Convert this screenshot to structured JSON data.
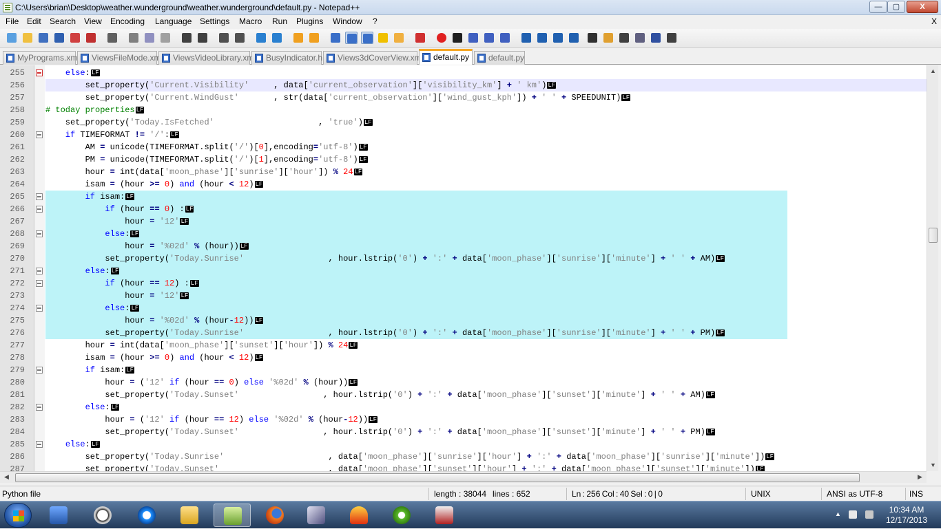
{
  "window": {
    "title": "C:\\Users\\brian\\Desktop\\weather.wunderground\\weather.wunderground\\default.py - Notepad++",
    "buttons": {
      "minimize": "—",
      "maximize": "▢",
      "close": "X"
    }
  },
  "menu": {
    "items": [
      "File",
      "Edit",
      "Search",
      "View",
      "Encoding",
      "Language",
      "Settings",
      "Macro",
      "Run",
      "Plugins",
      "Window",
      "?"
    ],
    "close_label": "X"
  },
  "toolbar": {
    "icons": [
      "new-file-icon",
      "open-file-icon",
      "save-icon",
      "save-all-icon",
      "close-file-icon",
      "close-all-icon",
      "print-icon",
      "cut-icon",
      "copy-icon",
      "paste-icon",
      "undo-icon",
      "redo-icon",
      "find-icon",
      "replace-icon",
      "zoom-in-icon",
      "zoom-out-icon",
      "sync-vertical-icon",
      "sync-horizontal-icon",
      "word-wrap-icon",
      "show-all-chars-icon",
      "indent-guide-icon",
      "user-language-icon",
      "doc-map-icon",
      "function-list-icon",
      "record-macro-icon",
      "stop-record-icon",
      "play-macro-icon",
      "run-macro-multiple-icon",
      "save-macro-icon",
      "collapse-icon",
      "prev-icon",
      "next-icon",
      "expand-icon",
      "spellcheck-icon",
      "highlight-icon",
      "compare-icon",
      "plugin-icon",
      "spell-icon",
      "print-preview-icon"
    ]
  },
  "tabs": [
    {
      "label": "MyPrograms.xml",
      "active": false
    },
    {
      "label": "ViewsFileMode.xml",
      "active": false
    },
    {
      "label": "ViewsVideoLibrary.xml",
      "active": false
    },
    {
      "label": "BusyIndicator.h",
      "active": false
    },
    {
      "label": "Views3dCoverView.xml",
      "active": false
    },
    {
      "label": "default.py",
      "active": true
    },
    {
      "label": "default.py",
      "active": false
    }
  ],
  "lines": [
    {
      "num": "255",
      "code": "    <span class=\"kw\">else</span>:"
    },
    {
      "num": "256",
      "code": "        set_property(<span class=\"st\">'Current.Visibility'</span>     , data[<span class=\"st\">'current_observation'</span>][<span class=\"st\">'visibility_km'</span>] <span class=\"op\">+</span> <span class=\"st\">' km'</span>)"
    },
    {
      "num": "257",
      "code": "        set_property(<span class=\"st\">'Current.WindGust'</span>       , str(data[<span class=\"st\">'current_observation'</span>][<span class=\"st\">'wind_gust_kph'</span>]) <span class=\"op\">+</span> <span class=\"st\">' '</span> <span class=\"op\">+</span> SPEEDUNIT)"
    },
    {
      "num": "258",
      "code": "<span class=\"cm\"># today properties</span>"
    },
    {
      "num": "259",
      "code": "    set_property(<span class=\"st\">'Today.IsFetched'</span>                     , <span class=\"st\">'true'</span>)"
    },
    {
      "num": "260",
      "code": "    <span class=\"kw\">if</span> TIMEFORMAT <span class=\"op\">!=</span> <span class=\"st\">'/'</span>:"
    },
    {
      "num": "261",
      "code": "        AM <span class=\"op\">=</span> unicode(TIMEFORMAT.split(<span class=\"st\">'/'</span>)[<span class=\"nm\">0</span>],encoding<span class=\"op\">=</span><span class=\"st\">'utf-8'</span>)"
    },
    {
      "num": "262",
      "code": "        PM <span class=\"op\">=</span> unicode(TIMEFORMAT.split(<span class=\"st\">'/'</span>)[<span class=\"nm\">1</span>],encoding<span class=\"op\">=</span><span class=\"st\">'utf-8'</span>)"
    },
    {
      "num": "263",
      "code": "        hour <span class=\"op\">=</span> int(data[<span class=\"st\">'moon_phase'</span>][<span class=\"st\">'sunrise'</span>][<span class=\"st\">'hour'</span>]) <span class=\"op\">%</span> <span class=\"nm\">24</span>"
    },
    {
      "num": "264",
      "code": "        isam <span class=\"op\">=</span> (hour <span class=\"op\">&gt;=</span> <span class=\"nm\">0</span>) <span class=\"kw\">and</span> (hour <span class=\"op\">&lt;</span> <span class=\"nm\">12</span>)"
    },
    {
      "num": "265",
      "code": "        <span class=\"kw\">if</span> isam:"
    },
    {
      "num": "266",
      "code": "            <span class=\"kw\">if</span> (hour <span class=\"op\">==</span> <span class=\"nm\">0</span>) :"
    },
    {
      "num": "267",
      "code": "                hour <span class=\"op\">=</span> <span class=\"st\">'12'</span>"
    },
    {
      "num": "268",
      "code": "            <span class=\"kw\">else</span>:"
    },
    {
      "num": "269",
      "code": "                hour <span class=\"op\">=</span> <span class=\"st\">'%02d'</span> <span class=\"op\">%</span> (hour))"
    },
    {
      "num": "270",
      "code": "            set_property(<span class=\"st\">'Today.Sunrise'</span>                 , hour.lstrip(<span class=\"st\">'0'</span>) <span class=\"op\">+</span> <span class=\"st\">':'</span> <span class=\"op\">+</span> data[<span class=\"st\">'moon_phase'</span>][<span class=\"st\">'sunrise'</span>][<span class=\"st\">'minute'</span>] <span class=\"op\">+</span> <span class=\"st\">' '</span> <span class=\"op\">+</span> AM)"
    },
    {
      "num": "271",
      "code": "        <span class=\"kw\">else</span>:"
    },
    {
      "num": "272",
      "code": "            <span class=\"kw\">if</span> (hour <span class=\"op\">==</span> <span class=\"nm\">12</span>) :"
    },
    {
      "num": "273",
      "code": "                hour <span class=\"op\">=</span> <span class=\"st\">'12'</span>"
    },
    {
      "num": "274",
      "code": "            <span class=\"kw\">else</span>:"
    },
    {
      "num": "275",
      "code": "                hour <span class=\"op\">=</span> <span class=\"st\">'%02d'</span> <span class=\"op\">%</span> (hour<span class=\"op\">-</span><span class=\"nm\">12</span>))"
    },
    {
      "num": "276",
      "code": "            set_property(<span class=\"st\">'Today.Sunrise'</span>                 , hour.lstrip(<span class=\"st\">'0'</span>) <span class=\"op\">+</span> <span class=\"st\">':'</span> <span class=\"op\">+</span> data[<span class=\"st\">'moon_phase'</span>][<span class=\"st\">'sunrise'</span>][<span class=\"st\">'minute'</span>] <span class=\"op\">+</span> <span class=\"st\">' '</span> <span class=\"op\">+</span> PM)"
    },
    {
      "num": "277",
      "code": "        hour <span class=\"op\">=</span> int(data[<span class=\"st\">'moon_phase'</span>][<span class=\"st\">'sunset'</span>][<span class=\"st\">'hour'</span>]) <span class=\"op\">%</span> <span class=\"nm\">24</span>"
    },
    {
      "num": "278",
      "code": "        isam <span class=\"op\">=</span> (hour <span class=\"op\">&gt;=</span> <span class=\"nm\">0</span>) <span class=\"kw\">and</span> (hour <span class=\"op\">&lt;</span> <span class=\"nm\">12</span>)"
    },
    {
      "num": "279",
      "code": "        <span class=\"kw\">if</span> isam:"
    },
    {
      "num": "280",
      "code": "            hour <span class=\"op\">=</span> (<span class=\"st\">'12'</span> <span class=\"kw\">if</span> (hour <span class=\"op\">==</span> <span class=\"nm\">0</span>) <span class=\"kw\">else</span> <span class=\"st\">'%02d'</span> <span class=\"op\">%</span> (hour))"
    },
    {
      "num": "281",
      "code": "            set_property(<span class=\"st\">'Today.Sunset'</span>                 , hour.lstrip(<span class=\"st\">'0'</span>) <span class=\"op\">+</span> <span class=\"st\">':'</span> <span class=\"op\">+</span> data[<span class=\"st\">'moon_phase'</span>][<span class=\"st\">'sunset'</span>][<span class=\"st\">'minute'</span>] <span class=\"op\">+</span> <span class=\"st\">' '</span> <span class=\"op\">+</span> AM)"
    },
    {
      "num": "282",
      "code": "        <span class=\"kw\">else</span>:"
    },
    {
      "num": "283",
      "code": "            hour <span class=\"op\">=</span> (<span class=\"st\">'12'</span> <span class=\"kw\">if</span> (hour <span class=\"op\">==</span> <span class=\"nm\">12</span>) <span class=\"kw\">else</span> <span class=\"st\">'%02d'</span> <span class=\"op\">%</span> (hour<span class=\"op\">-</span><span class=\"nm\">12</span>))"
    },
    {
      "num": "284",
      "code": "            set_property(<span class=\"st\">'Today.Sunset'</span>                 , hour.lstrip(<span class=\"st\">'0'</span>) <span class=\"op\">+</span> <span class=\"st\">':'</span> <span class=\"op\">+</span> data[<span class=\"st\">'moon_phase'</span>][<span class=\"st\">'sunset'</span>][<span class=\"st\">'minute'</span>] <span class=\"op\">+</span> <span class=\"st\">' '</span> <span class=\"op\">+</span> PM)"
    },
    {
      "num": "285",
      "code": "    <span class=\"kw\">else</span>:"
    },
    {
      "num": "286",
      "code": "        set_property(<span class=\"st\">'Today.Sunrise'</span>                     , data[<span class=\"st\">'moon_phase'</span>][<span class=\"st\">'sunrise'</span>][<span class=\"st\">'hour'</span>] <span class=\"op\">+</span> <span class=\"st\">':'</span> <span class=\"op\">+</span> data[<span class=\"st\">'moon_phase'</span>][<span class=\"st\">'sunrise'</span>][<span class=\"st\">'minute'</span>])"
    },
    {
      "num": "287",
      "code": "        set_property(<span class=\"st\">'Today.Sunset'</span>                      , data[<span class=\"st\">'moon_phase'</span>][<span class=\"st\">'sunset'</span>][<span class=\"st\">'hour'</span>] <span class=\"op\">+</span> <span class=\"st\">':'</span> <span class=\"op\">+</span> data[<span class=\"st\">'moon_phase'</span>][<span class=\"st\">'sunset'</span>][<span class=\"st\">'minute'</span>])"
    }
  ],
  "eol_marker": "LF",
  "status": {
    "file_type": "Python file",
    "length": "length : 38044",
    "lines": "lines : 652",
    "position": "Ln : 256    Col : 40    Sel : 0 | 0",
    "eol": "UNIX",
    "encoding": "ANSI as UTF-8",
    "mode": "INS"
  },
  "taskbar": {
    "time": "10:34 AM",
    "date": "12/17/2013"
  }
}
